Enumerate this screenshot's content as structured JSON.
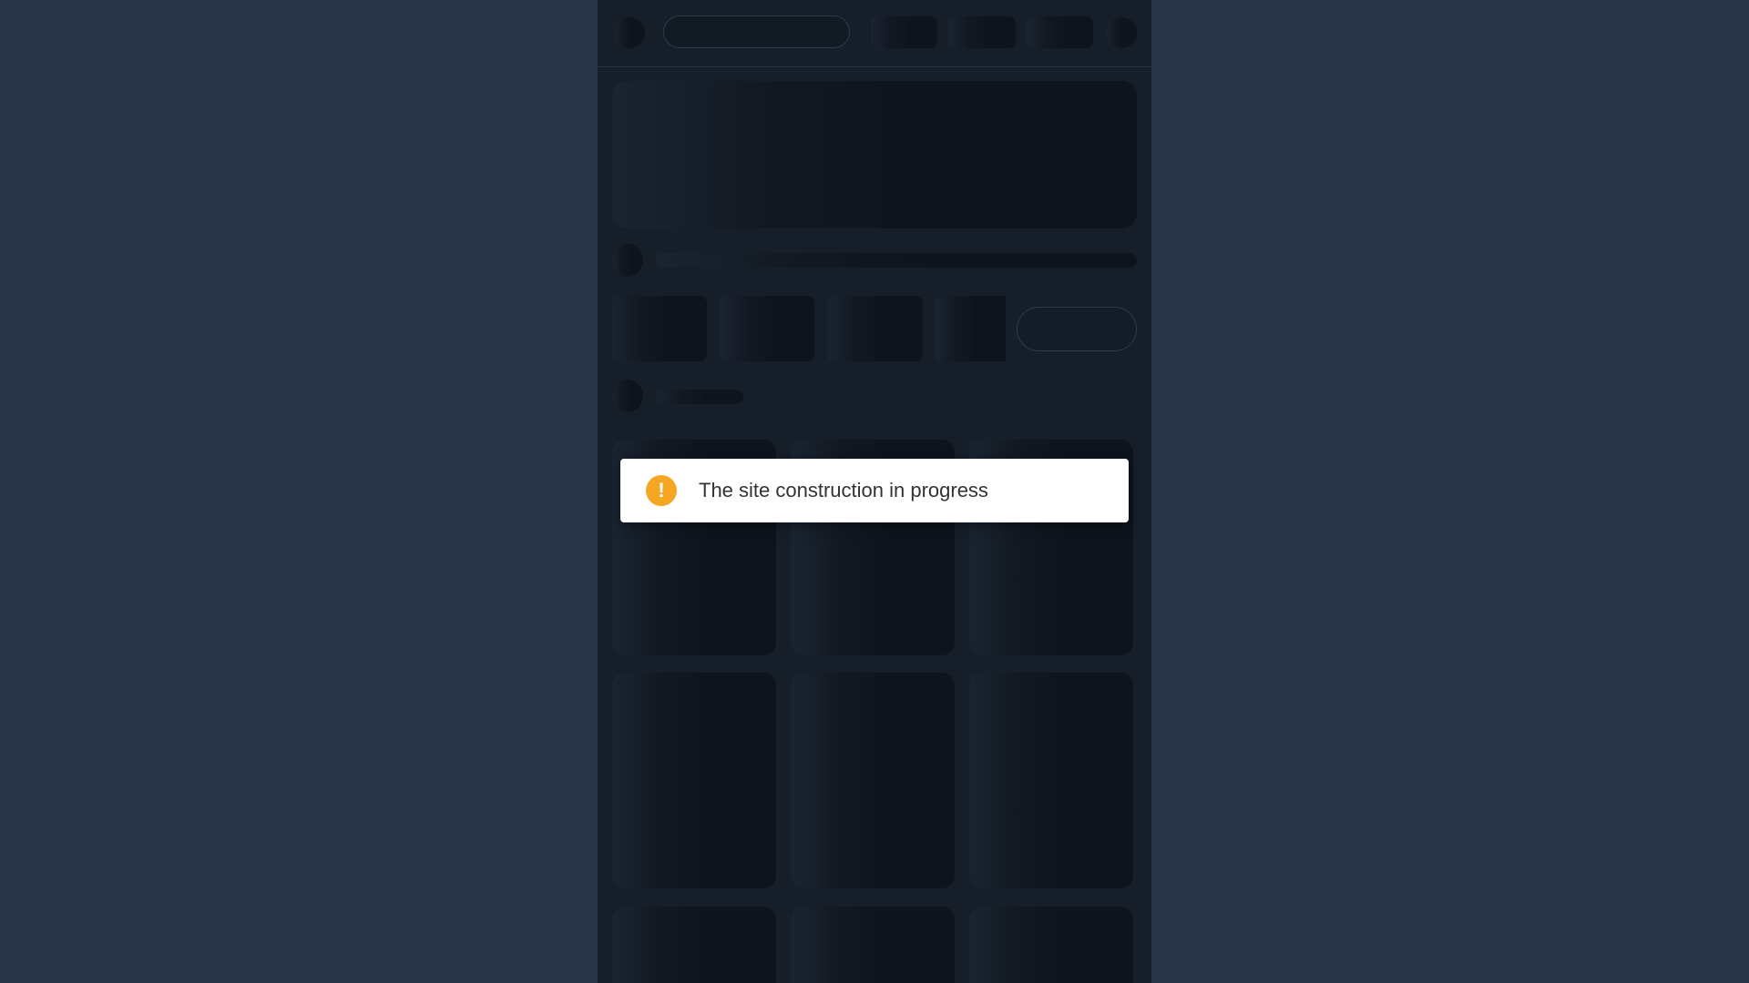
{
  "page": {
    "background_color": "#283548",
    "panel_color": "#161e2a",
    "skeleton_color": "#0e141c"
  },
  "toast": {
    "icon": "warning-exclamation-icon",
    "icon_glyph": "!",
    "icon_color": "#f5a623",
    "message": "The site construction in progress"
  }
}
